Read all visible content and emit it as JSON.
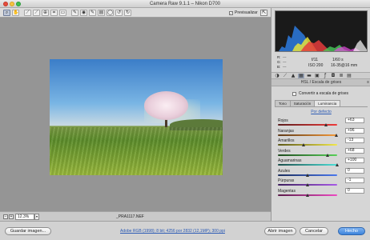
{
  "window": {
    "title": "Camera Raw 9.1.1  –  Nikon D700"
  },
  "toolbar": {
    "tools": [
      "zoom-tool",
      "hand-tool",
      "white-balance-tool",
      "color-sampler-tool",
      "target-adjustment-tool",
      "crop-tool",
      "straighten-tool",
      "spot-removal-tool",
      "red-eye-tool",
      "adjustment-brush-tool",
      "graduated-filter-tool",
      "radial-filter-tool",
      "rotate-ccw-tool",
      "rotate-cw-tool"
    ],
    "preview_label": "Previsualizar",
    "preview_checked": true
  },
  "status": {
    "zoom_minus": "−",
    "zoom_plus": "+",
    "zoom_value": "12.3%",
    "zoom_arrow": "▾",
    "filename": "_PRA1117.NEF"
  },
  "info": {
    "r_label": "R:",
    "r_value": "---",
    "g_label": "G:",
    "g_value": "---",
    "b_label": "B:",
    "b_value": "---",
    "aperture": "f/11",
    "shutter": "1/60 s",
    "iso": "ISO 200",
    "lens": "16-35@16 mm"
  },
  "panel": {
    "header": "HSL / Escala de grises",
    "menu_icon": "≡",
    "convert_label": "Convertir a escala de grises",
    "tabs": [
      "Tono",
      "Saturación",
      "Luminancia"
    ],
    "active_tab": 2,
    "default_link": "Por defecto",
    "sliders": [
      {
        "label": "Rojos",
        "value": "+63",
        "level": 0.815,
        "track": "linear-gradient(90deg,#5a1d1d,#f03a3a)"
      },
      {
        "label": "Naranjas",
        "value": "+96",
        "level": 0.98,
        "track": "linear-gradient(90deg,#5e3a18,#f59a3a)"
      },
      {
        "label": "Amarillos",
        "value": "-13",
        "level": 0.435,
        "track": "linear-gradient(90deg,#5b5718,#f2e84a)"
      },
      {
        "label": "Verdes",
        "value": "+68",
        "level": 0.84,
        "track": "linear-gradient(90deg,#1e4a1e,#58d058)"
      },
      {
        "label": "Aguamarinas",
        "value": "+100",
        "level": 1.0,
        "track": "linear-gradient(90deg,#1b4d4a,#4de0d8)"
      },
      {
        "label": "Azules",
        "value": "0",
        "level": 0.5,
        "track": "linear-gradient(90deg,#1b2c5c,#4a78ee)"
      },
      {
        "label": "Púrpuras",
        "value": "-1",
        "level": 0.495,
        "track": "linear-gradient(90deg,#3b1d5c,#a85ae8)"
      },
      {
        "label": "Magentas",
        "value": "0",
        "level": 0.5,
        "track": "linear-gradient(90deg,#5a1b4a,#ee4ac2)"
      }
    ]
  },
  "bottom": {
    "save_label": "Guardar imagen...",
    "workflow_link": "Adobe RGB (1998); 8 bit; 4256 por 2832 (12,1MP); 300 ppi",
    "open_label": "Abrir imagen",
    "cancel_label": "Cancelar",
    "done_label": "Hecho"
  }
}
